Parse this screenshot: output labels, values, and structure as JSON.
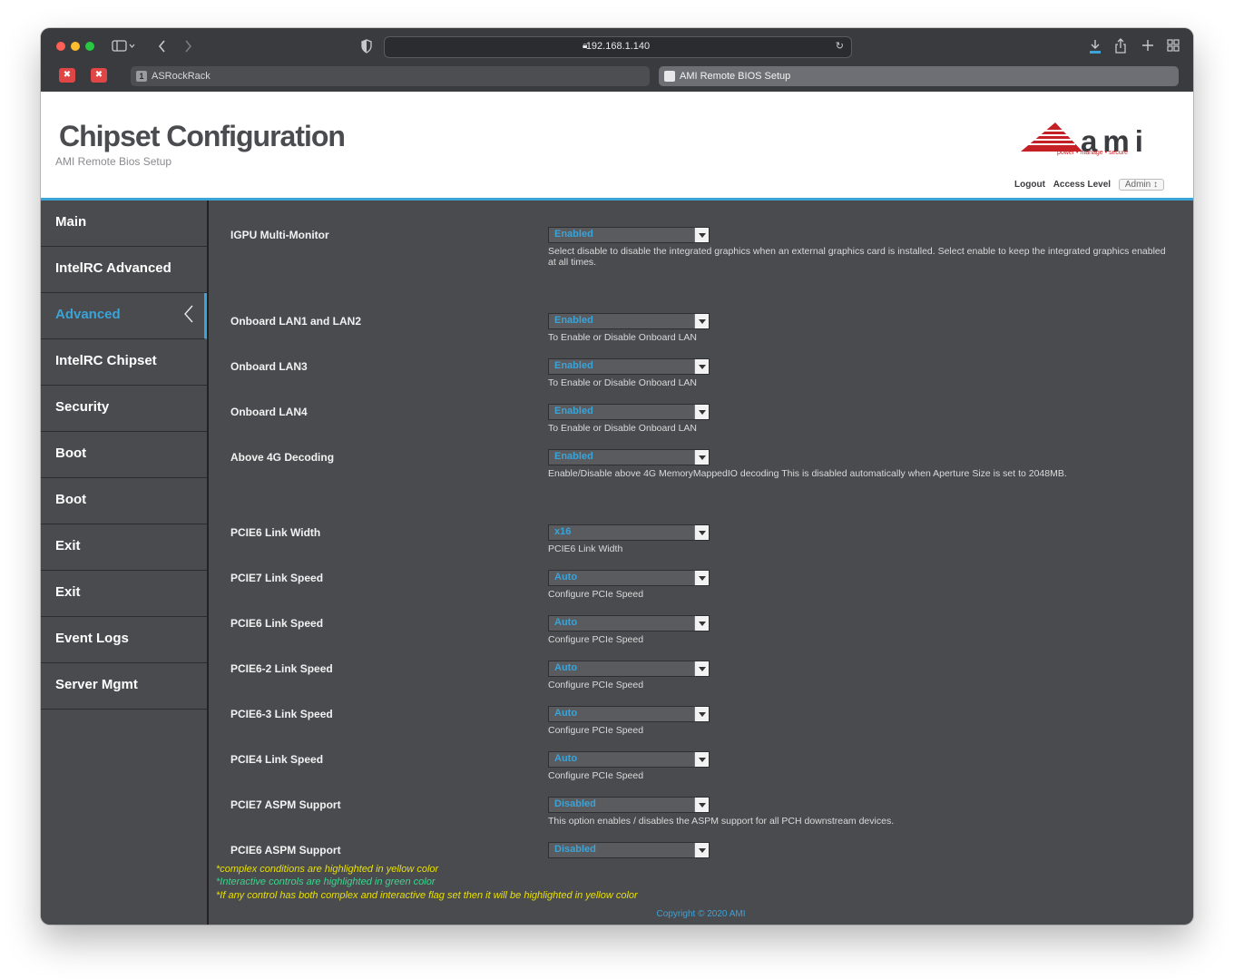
{
  "browser": {
    "url": "192.168.1.140",
    "tabs": [
      {
        "badge": "1",
        "label": "ASRockRack"
      },
      {
        "label": "AMI Remote BIOS Setup"
      }
    ]
  },
  "header": {
    "title": "Chipset Configuration",
    "subtitle": "AMI Remote Bios Setup",
    "logo_text": "ami",
    "logo_tagline": "power • manage • secure",
    "logout": "Logout",
    "access_level_label": "Access Level",
    "access_level_value": "Admin"
  },
  "sidebar": {
    "items": [
      {
        "label": "Main"
      },
      {
        "label": "IntelRC Advanced"
      },
      {
        "label": "Advanced"
      },
      {
        "label": "IntelRC Chipset"
      },
      {
        "label": "Security"
      },
      {
        "label": "Boot"
      },
      {
        "label": "Boot"
      },
      {
        "label": "Exit"
      },
      {
        "label": "Exit"
      },
      {
        "label": "Event Logs"
      },
      {
        "label": "Server Mgmt"
      }
    ]
  },
  "settings": [
    {
      "label": "IGPU Multi-Monitor",
      "value": "Enabled",
      "desc": "Select disable to disable the integrated graphics when an external graphics card is installed. Select enable to keep the integrated graphics enabled at all times."
    },
    {
      "label": "Onboard LAN1 and LAN2",
      "value": "Enabled",
      "desc": "To Enable or Disable Onboard LAN"
    },
    {
      "label": "Onboard LAN3",
      "value": "Enabled",
      "desc": "To Enable or Disable Onboard LAN"
    },
    {
      "label": "Onboard LAN4",
      "value": "Enabled",
      "desc": "To Enable or Disable Onboard LAN"
    },
    {
      "label": "Above 4G Decoding",
      "value": "Enabled",
      "desc": "Enable/Disable above 4G MemoryMappedIO decoding This is disabled automatically when Aperture Size is set to 2048MB."
    },
    {
      "label": "PCIE6 Link Width",
      "value": "x16",
      "desc": "PCIE6 Link Width"
    },
    {
      "label": "PCIE7 Link Speed",
      "value": "Auto",
      "desc": "Configure PCIe Speed"
    },
    {
      "label": "PCIE6 Link Speed",
      "value": "Auto",
      "desc": "Configure PCIe Speed"
    },
    {
      "label": "PCIE6-2 Link Speed",
      "value": "Auto",
      "desc": "Configure PCIe Speed"
    },
    {
      "label": "PCIE6-3 Link Speed",
      "value": "Auto",
      "desc": "Configure PCIe Speed"
    },
    {
      "label": "PCIE4 Link Speed",
      "value": "Auto",
      "desc": "Configure PCIe Speed"
    },
    {
      "label": "PCIE7 ASPM Support",
      "value": "Disabled",
      "desc": "This option enables / disables the ASPM support for all PCH downstream devices."
    },
    {
      "label": "PCIE6 ASPM Support",
      "value": "Disabled",
      "desc": ""
    }
  ],
  "notes": [
    "*complex conditions are highlighted in yellow color",
    "*Interactive controls are highlighted in green color",
    "*If any control has both complex and interactive flag set then it will be highlighted in yellow color"
  ],
  "footer": {
    "copyright": "Copyright © 2020 AMI"
  },
  "colors": {
    "accent": "#3aa3d8",
    "panel": "#4a4b4f",
    "note_yellow": "#e8e000",
    "note_green": "#3ad68c",
    "logo_red": "#c42026"
  }
}
